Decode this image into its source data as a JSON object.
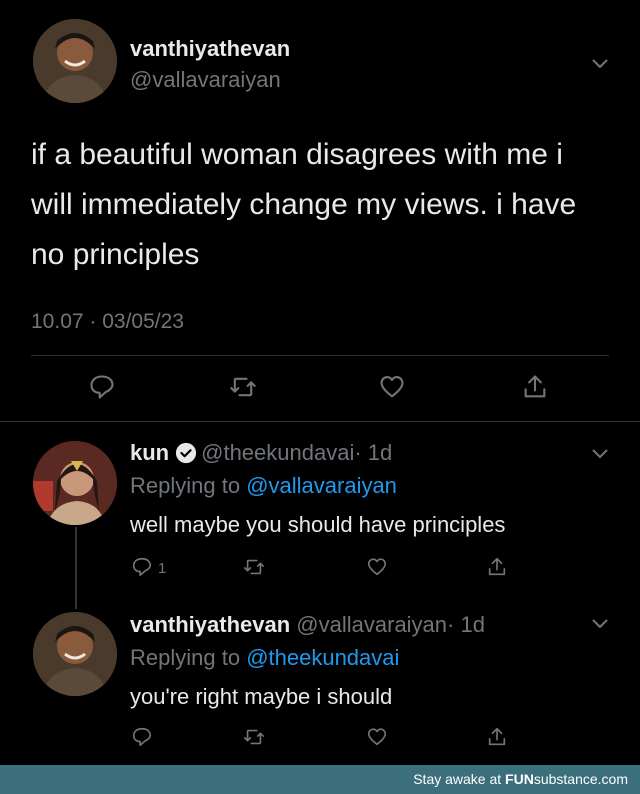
{
  "main_tweet": {
    "display_name": "vanthiyathevan",
    "handle": "@vallavaraiyan",
    "text": "if a beautiful woman disagrees with me i will immediately change my views. i have no principles",
    "timestamp": "10.07 · 03/05/23"
  },
  "reply_1": {
    "display_name": "kun",
    "handle": "@theekundavai",
    "age": "· 1d",
    "replying_prefix": "Replying to ",
    "replying_to": "@vallavaraiyan",
    "text": "well maybe you should have principles",
    "reply_count": "1"
  },
  "reply_2": {
    "display_name": "vanthiyathevan",
    "handle": "@vallavaraiyan",
    "age": "· 1d",
    "replying_prefix": "Replying to ",
    "replying_to": "@theekundavai",
    "text": "you're right maybe i should"
  },
  "footer": {
    "prefix": "Stay awake at ",
    "brand_bold": "FUN",
    "brand_rest": "substance.com"
  },
  "colors": {
    "background": "#000000",
    "accent_link": "#1d9bf0",
    "muted": "#71767b",
    "footer_bar": "#3b6f7c"
  },
  "icons": [
    "reply-icon",
    "retweet-icon",
    "like-icon",
    "share-icon",
    "chevron-down-icon",
    "verified-badge-icon"
  ]
}
